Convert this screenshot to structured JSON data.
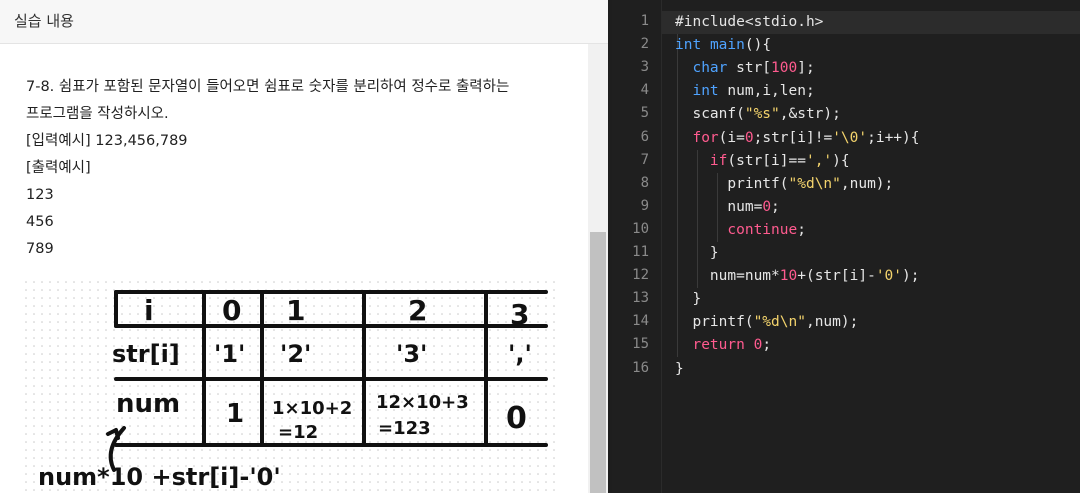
{
  "header": {
    "title": "실습 내용"
  },
  "problem": {
    "lines": [
      "7-8. 쉼표가 포함된 문자열이 들어오면 쉼표로 숫자를 분리하여 정수로 출력하는",
      "프로그램을 작성하시오.",
      "[입력예시] 123,456,789",
      "[출력예시]",
      "123",
      "456",
      "789"
    ]
  },
  "sketch": {
    "header_cells": [
      "i",
      "0",
      "1",
      "2",
      "3"
    ],
    "row_str": [
      "str[i]",
      "'1'",
      "'2'",
      "'3'",
      "','"
    ],
    "row_num": [
      "num",
      "1",
      "1×10+2",
      "=12",
      "12×10+3",
      "=123",
      "0"
    ],
    "formula": "num*10 +str[i]-'0'"
  },
  "editor": {
    "line_numbers": [
      "1",
      "2",
      "3",
      "4",
      "5",
      "6",
      "7",
      "8",
      "9",
      "10",
      "11",
      "12",
      "13",
      "14",
      "15",
      "16"
    ],
    "colors": {
      "background": "#1f1f1f",
      "keyword": "#4fa3ff",
      "control": "#ff5b8f",
      "string": "#f3d36c"
    },
    "code": [
      [
        {
          "t": "#include<stdio.h>",
          "c": "pp"
        }
      ],
      [
        {
          "t": "int",
          "c": "kw"
        },
        {
          "t": " "
        },
        {
          "t": "main",
          "c": "kw"
        },
        {
          "t": "(){"
        }
      ],
      [
        {
          "t": "  "
        },
        {
          "t": "char",
          "c": "kw"
        },
        {
          "t": " str["
        },
        {
          "t": "100",
          "c": "num"
        },
        {
          "t": "];"
        }
      ],
      [
        {
          "t": "  "
        },
        {
          "t": "int",
          "c": "kw"
        },
        {
          "t": " num,i,len;"
        }
      ],
      [
        {
          "t": "  scanf("
        },
        {
          "t": "\"%s\"",
          "c": "str"
        },
        {
          "t": ",&str);"
        }
      ],
      [
        {
          "t": "  "
        },
        {
          "t": "for",
          "c": "kw2"
        },
        {
          "t": "(i="
        },
        {
          "t": "0",
          "c": "num"
        },
        {
          "t": ";str[i]!="
        },
        {
          "t": "'\\0'",
          "c": "str"
        },
        {
          "t": ";i++){"
        }
      ],
      [
        {
          "t": "    "
        },
        {
          "t": "if",
          "c": "kw2"
        },
        {
          "t": "(str[i]=="
        },
        {
          "t": "','",
          "c": "str"
        },
        {
          "t": "){"
        }
      ],
      [
        {
          "t": "      printf("
        },
        {
          "t": "\"%d\\n\"",
          "c": "str"
        },
        {
          "t": ",num);"
        }
      ],
      [
        {
          "t": "      num="
        },
        {
          "t": "0",
          "c": "num"
        },
        {
          "t": ";"
        }
      ],
      [
        {
          "t": "      "
        },
        {
          "t": "continue",
          "c": "kw2"
        },
        {
          "t": ";"
        }
      ],
      [
        {
          "t": "    }"
        }
      ],
      [
        {
          "t": "    num=num*"
        },
        {
          "t": "10",
          "c": "num"
        },
        {
          "t": "+(str[i]-"
        },
        {
          "t": "'0'",
          "c": "str"
        },
        {
          "t": ");"
        }
      ],
      [
        {
          "t": "  }"
        }
      ],
      [
        {
          "t": "  printf("
        },
        {
          "t": "\"%d\\n\"",
          "c": "str"
        },
        {
          "t": ",num);"
        }
      ],
      [
        {
          "t": "  "
        },
        {
          "t": "return",
          "c": "kw2"
        },
        {
          "t": " "
        },
        {
          "t": "0",
          "c": "num"
        },
        {
          "t": ";"
        }
      ],
      [
        {
          "t": "}"
        }
      ]
    ]
  }
}
